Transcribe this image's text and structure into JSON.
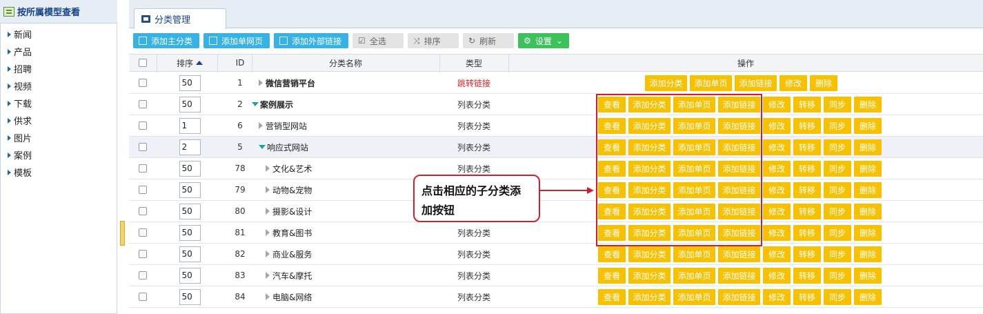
{
  "sidebar": {
    "title": "按所属模型查看",
    "items": [
      {
        "label": "新闻"
      },
      {
        "label": "产品"
      },
      {
        "label": "招聘"
      },
      {
        "label": "视频"
      },
      {
        "label": "下载"
      },
      {
        "label": "供求"
      },
      {
        "label": "图片"
      },
      {
        "label": "案例"
      },
      {
        "label": "模板"
      }
    ]
  },
  "tab": {
    "label": "分类管理"
  },
  "toolbar": {
    "add_main": "添加主分类",
    "add_page": "添加单网页",
    "add_external": "添加外部链接",
    "select_all": "全选",
    "sort": "排序",
    "refresh": "刷新",
    "settings": "设置"
  },
  "table": {
    "headers": {
      "sort": "排序",
      "id": "ID",
      "name": "分类名称",
      "type": "类型",
      "ops": "操作"
    },
    "rows": [
      {
        "sort": "50",
        "id": "1",
        "name": "微信营销平台",
        "type": "跳转链接",
        "expander": "collapsed",
        "bold": true,
        "type_red": true
      },
      {
        "sort": "50",
        "id": "2",
        "name": "案例展示",
        "type": "列表分类",
        "expander": "expanded",
        "bold": true
      },
      {
        "sort": "1",
        "id": "6",
        "name": "营销型网站",
        "type": "列表分类",
        "expander": "collapsed"
      },
      {
        "sort": "2",
        "id": "5",
        "name": "响应式网站",
        "type": "列表分类",
        "expander": "expanded",
        "selected": true
      },
      {
        "sort": "50",
        "id": "78",
        "name": "文化&艺术",
        "type": "列表分类",
        "expander": "collapsed"
      },
      {
        "sort": "50",
        "id": "79",
        "name": "动物&宠物",
        "type": "",
        "expander": "collapsed"
      },
      {
        "sort": "50",
        "id": "80",
        "name": "摄影&设计",
        "type": "",
        "expander": "collapsed"
      },
      {
        "sort": "50",
        "id": "81",
        "name": "教育&图书",
        "type": "列表分类",
        "expander": "collapsed"
      },
      {
        "sort": "50",
        "id": "82",
        "name": "商业&服务",
        "type": "列表分类",
        "expander": "collapsed"
      },
      {
        "sort": "50",
        "id": "83",
        "name": "汽车&摩托",
        "type": "列表分类",
        "expander": "collapsed"
      },
      {
        "sort": "50",
        "id": "84",
        "name": "电脑&网络",
        "type": "列表分类",
        "expander": "collapsed"
      }
    ],
    "ops_link_row": [
      "添加分类",
      "添加单页",
      "添加链接",
      "修改",
      "删除"
    ],
    "ops_list_row": [
      "查看",
      "添加分类",
      "添加单页",
      "添加链接",
      "修改",
      "转移",
      "同步",
      "删除"
    ]
  },
  "annotation": {
    "line1": "点击相应的子分类添",
    "line2": "加按钮"
  },
  "colors": {
    "op_button": "#f8c100",
    "toolbar_blue": "#36b3e6",
    "toolbar_green": "#3cc15b",
    "annotation_red": "#d21e2b"
  }
}
